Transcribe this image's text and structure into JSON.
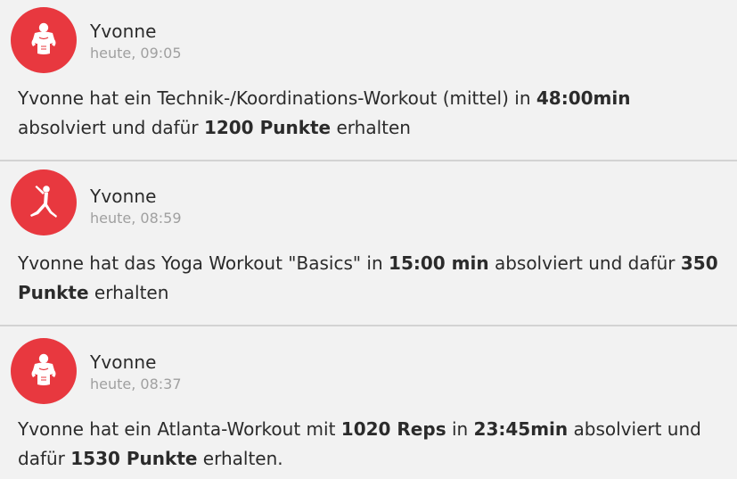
{
  "colors": {
    "avatar_background": "#e8383f",
    "background": "#f2f2f2",
    "divider": "#d3d3d3",
    "timestamp": "#a0a0a0",
    "text": "#2b2b2b"
  },
  "feed": {
    "items": [
      {
        "icon": "strength-athlete-icon",
        "user": "Yvonne",
        "time": "heute, 09:05",
        "message": {
          "t1": "Yvonne hat ein Technik-/Koordinations-Workout (mittel) in ",
          "b1": "48:00min",
          "t2": " absolviert und dafür ",
          "b2": "1200 Punkte",
          "t3": " erhalten"
        }
      },
      {
        "icon": "yoga-pose-icon",
        "user": "Yvonne",
        "time": "heute, 08:59",
        "message": {
          "t1": "Yvonne hat das Yoga Workout \"Basics\" in ",
          "b1": "15:00 min",
          "t2": " absolviert und dafür ",
          "b2": "350 Punkte",
          "t3": " erhalten"
        }
      },
      {
        "icon": "strength-athlete-icon",
        "user": "Yvonne",
        "time": "heute, 08:37",
        "message": {
          "t1": "Yvonne hat ein Atlanta-Workout mit ",
          "b1": "1020 Reps",
          "t2": " in ",
          "b2": "23:45min",
          "t3": " absolviert und dafür ",
          "b3": "1530 Punkte",
          "t4": " erhalten."
        }
      }
    ]
  }
}
